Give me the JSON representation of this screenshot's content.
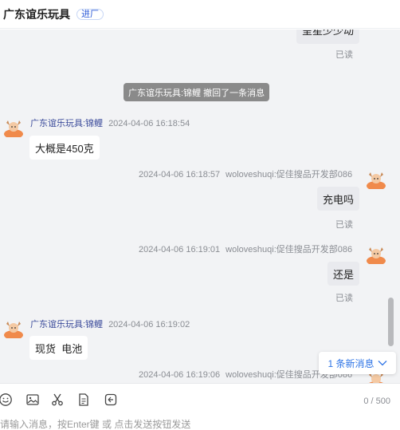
{
  "header": {
    "title": "广东谊乐玩具",
    "badge": "进厂"
  },
  "messages": {
    "partial_bubble": "呈星少少动",
    "read_1": "已读",
    "recall_notice": "广东谊乐玩具:锦鲤 撤回了一条消息",
    "m1": {
      "sender": "广东谊乐玩具:锦鲤",
      "time": "2024-04-06 16:18:54",
      "text": "大概是450克"
    },
    "m2": {
      "time": "2024-04-06 16:18:57",
      "sender": "woloveshuqi:促佳搜品开发部086",
      "text": "充电吗",
      "read": "已读"
    },
    "m3": {
      "time": "2024-04-06 16:19:01",
      "sender": "woloveshuqi:促佳搜品开发部086",
      "text": "还是",
      "read": "已读"
    },
    "m4": {
      "sender": "广东谊乐玩具:锦鲤",
      "time": "2024-04-06 16:19:02",
      "text": "现货  电池"
    },
    "m5": {
      "time": "2024-04-06 16:19:06",
      "sender": "woloveshuqi:促佳搜品开发部086"
    }
  },
  "new_messages": "1 条新消息",
  "toolbar": {
    "icons": [
      "emoji-icon",
      "image-icon",
      "scissors-icon",
      "document-icon",
      "history-icon"
    ],
    "counter": "0 / 500"
  },
  "input": {
    "placeholder": "请输入消息，按Enter键 或 点击发送按钮发送"
  },
  "colors": {
    "accent": "#2e74e6",
    "avatar": "#f08a4b",
    "chat_bg": "#f2f3f5"
  }
}
